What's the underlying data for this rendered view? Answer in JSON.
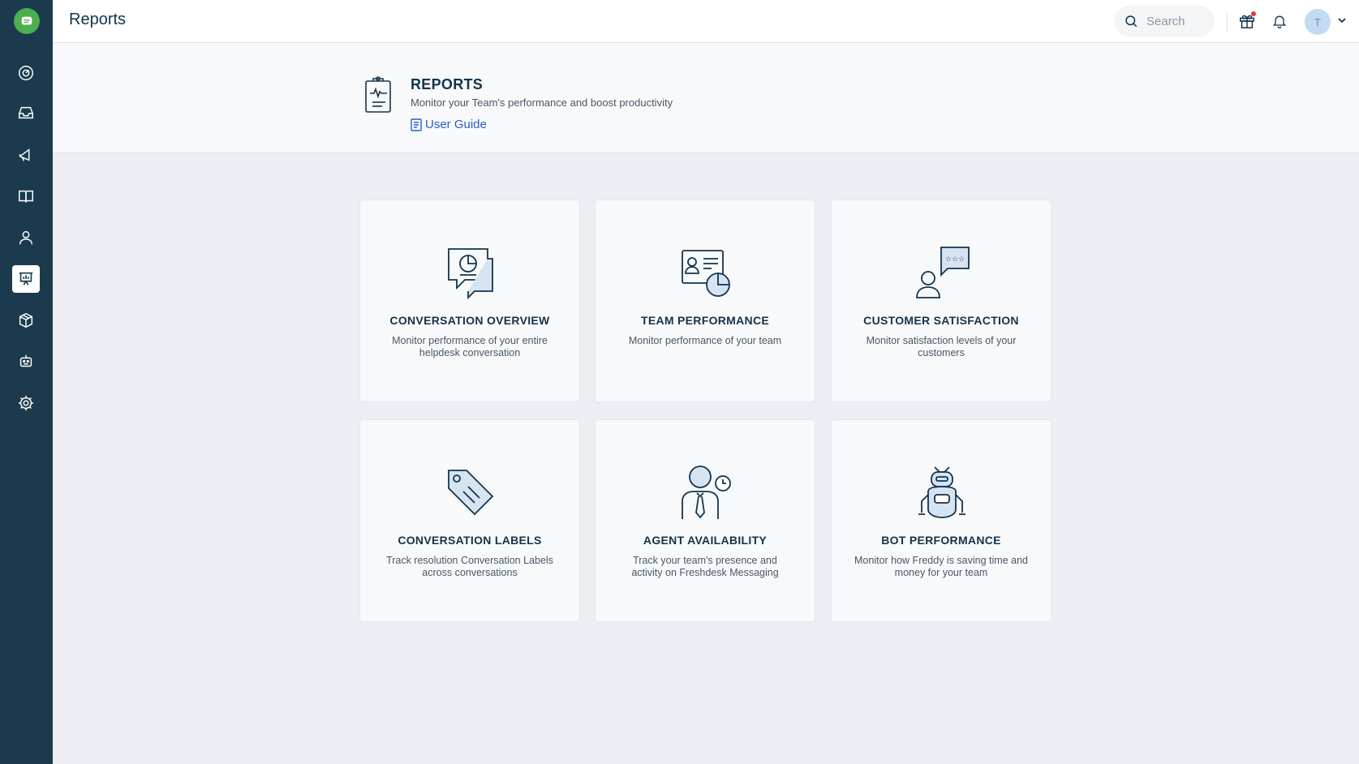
{
  "topbar": {
    "title": "Reports",
    "search_placeholder": "Search",
    "avatar_initial": "T"
  },
  "header": {
    "title": "REPORTS",
    "subtitle": "Monitor your Team's performance and boost productivity",
    "guide_label": "User Guide"
  },
  "sidebar": {
    "items": [
      {
        "icon": "dashboard-icon"
      },
      {
        "icon": "inbox-icon"
      },
      {
        "icon": "megaphone-icon"
      },
      {
        "icon": "book-icon"
      },
      {
        "icon": "contact-icon"
      },
      {
        "icon": "reports-icon",
        "active": true
      },
      {
        "icon": "box-icon"
      },
      {
        "icon": "bot-icon"
      },
      {
        "icon": "gear-icon"
      }
    ]
  },
  "cards": [
    {
      "title": "CONVERSATION OVERVIEW",
      "desc": "Monitor performance of your entire helpdesk conversation"
    },
    {
      "title": "TEAM PERFORMANCE",
      "desc": "Monitor performance of your team"
    },
    {
      "title": "CUSTOMER SATISFACTION",
      "desc": "Monitor satisfaction levels of your customers"
    },
    {
      "title": "CONVERSATION LABELS",
      "desc": "Track resolution Conversation Labels across conversations"
    },
    {
      "title": "AGENT AVAILABILITY",
      "desc": "Track your team's presence and activity on Freshdesk Messaging"
    },
    {
      "title": "BOT PERFORMANCE",
      "desc": "Monitor how Freddy is saving time and money for your team"
    }
  ],
  "colors": {
    "sidebar": "#1b3a4e",
    "accent_link": "#2c5cc5",
    "logo": "#4caf50",
    "notification_dot": "#e43538"
  }
}
